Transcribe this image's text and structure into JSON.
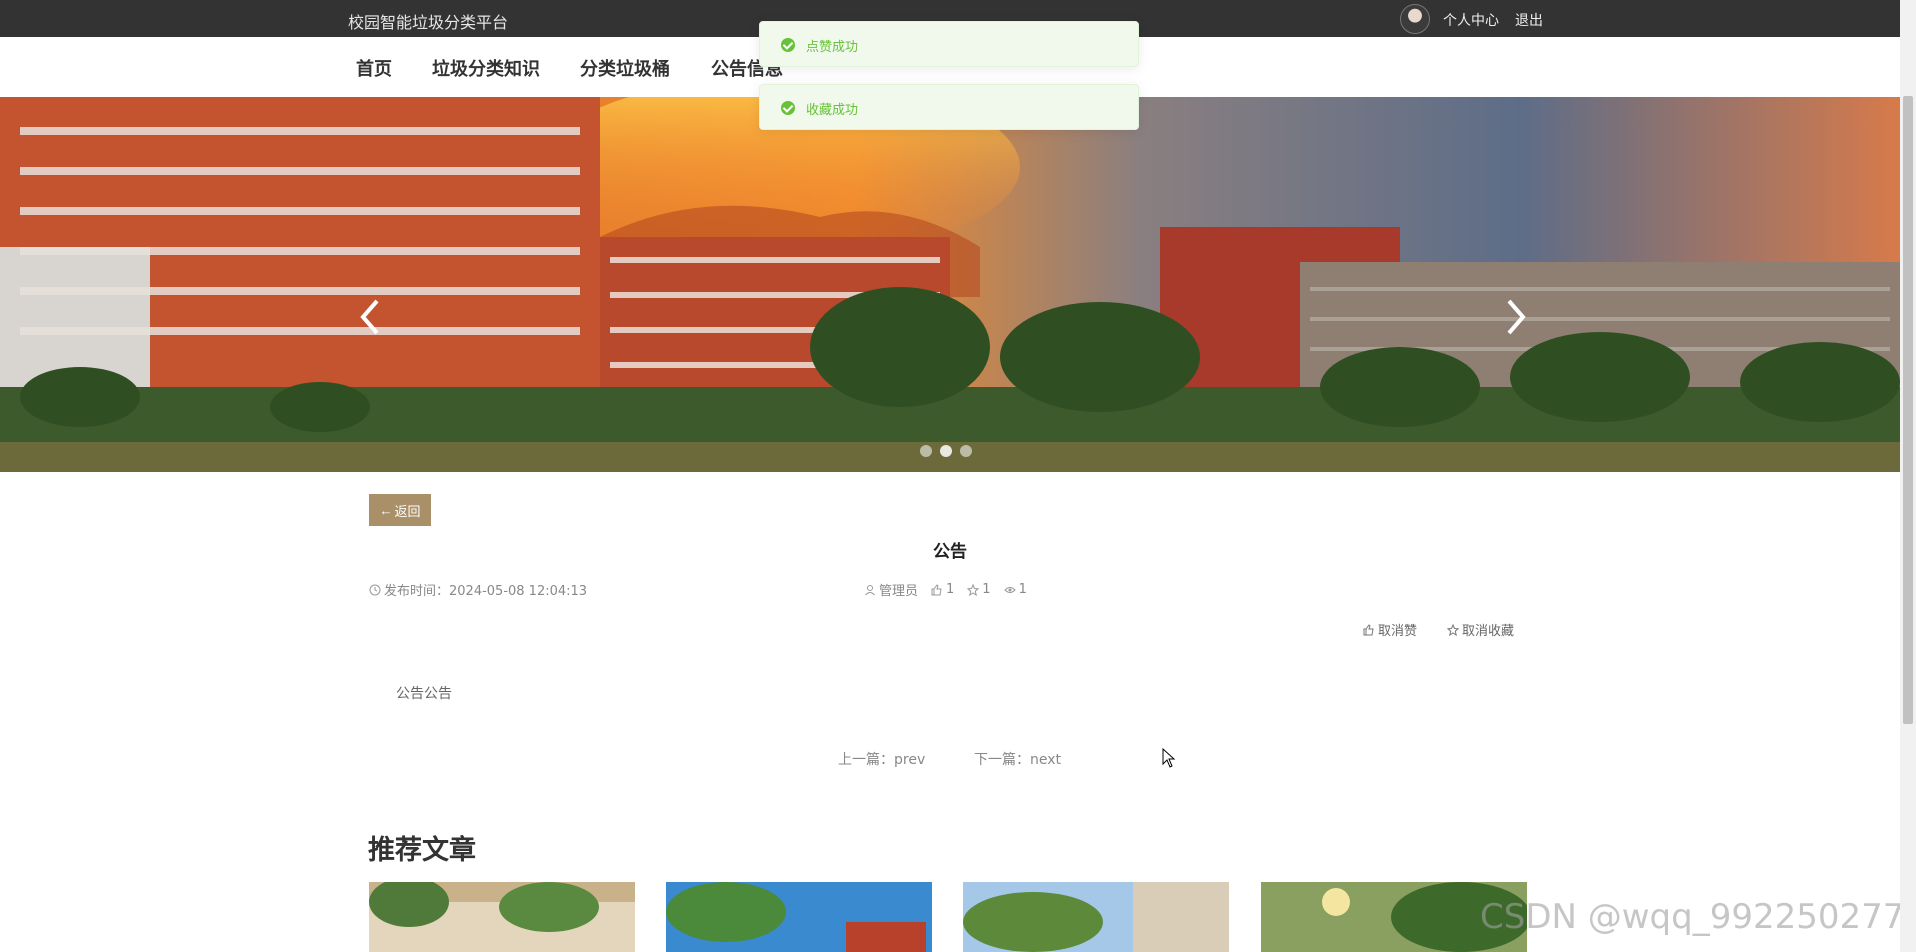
{
  "header": {
    "site_title": "校园智能垃圾分类平台",
    "user_center": "个人中心",
    "logout": "退出"
  },
  "nav": {
    "items": [
      {
        "label": "首页"
      },
      {
        "label": "垃圾分类知识"
      },
      {
        "label": "分类垃圾桶"
      },
      {
        "label": "公告信息"
      }
    ]
  },
  "toasts": [
    {
      "message": "点赞成功"
    },
    {
      "message": "收藏成功"
    }
  ],
  "banner": {
    "slide_count": 3,
    "active_slide": 1
  },
  "detail": {
    "back_label": "返回",
    "title": "公告",
    "publish_time": "发布时间：2024-05-08 12:04:13",
    "author": "管理员",
    "likes": "1",
    "favorites": "1",
    "views": "1",
    "unlike_label": "取消赞",
    "unfavorite_label": "取消收藏",
    "content": "公告公告",
    "prev_label": "上一篇：prev",
    "next_label": "下一篇：next"
  },
  "recommend": {
    "title": "推荐文章"
  },
  "watermark": "CSDN @wqq_992250277",
  "colors": {
    "topbar": "#333333",
    "accent_button": "#a99068",
    "toast_bg": "#f0f9eb",
    "toast_text": "#67c23a"
  }
}
